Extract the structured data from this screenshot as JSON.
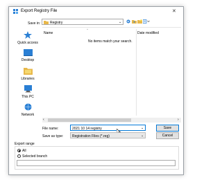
{
  "window": {
    "title": "Export Registry File",
    "close_glyph": "✕"
  },
  "save_in": {
    "label": "Save in:",
    "value": "Registry"
  },
  "sidebar": {
    "items": [
      {
        "label": "Quick access",
        "icon": "star-icon"
      },
      {
        "label": "Desktop",
        "icon": "desktop-icon"
      },
      {
        "label": "Libraries",
        "icon": "libraries-icon"
      },
      {
        "label": "This PC",
        "icon": "computer-icon"
      },
      {
        "label": "Network",
        "icon": "network-icon"
      }
    ]
  },
  "file_list": {
    "col_name": "Name",
    "col_date": "Date modified",
    "empty_message": "No items match your search."
  },
  "form": {
    "file_name_label": "File name:",
    "file_name_value": "2021 10 14 registry",
    "save_as_label": "Save as type:",
    "save_as_value": "Registration Files (*.reg)",
    "save_button": "Save",
    "cancel_button": "Cancel"
  },
  "export_range": {
    "label": "Export range",
    "all_label": "All",
    "branch_label": "Selected branch",
    "selected": "All"
  },
  "colors": {
    "accent": "#0078d7",
    "folder": "#e8b84a"
  }
}
